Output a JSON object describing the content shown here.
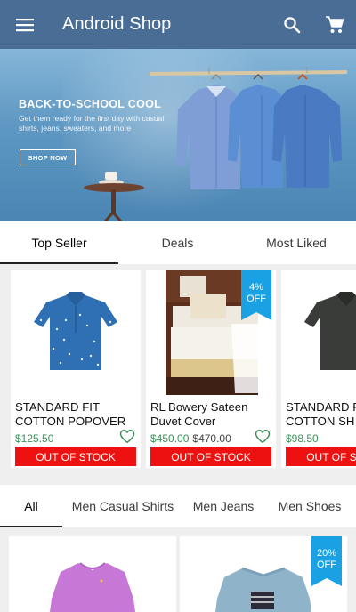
{
  "app": {
    "title": "Android Shop"
  },
  "banner": {
    "headline": "BACK-TO-SCHOOL COOL",
    "subtext": "Get them ready for the first day with casual shirts, jeans, sweaters, and more",
    "cta": "SHOP NOW",
    "slide_count": 5,
    "active_slide": 3
  },
  "section_tabs": [
    "Top Seller",
    "Deals",
    "Most Liked"
  ],
  "section_tab_active": 0,
  "products": [
    {
      "name": "STANDARD FIT COTTON POPOVER",
      "price": "$125.50",
      "old_price": "",
      "status": "OUT OF STOCK",
      "discount": ""
    },
    {
      "name": "RL Bowery Sateen Duvet Cover",
      "price": "$450.00",
      "old_price": "$470.00",
      "status": "OUT OF STOCK",
      "discount": "4% OFF"
    },
    {
      "name": "STANDARD FIT COTTON SH",
      "price": "$98.50",
      "old_price": "",
      "status": "OUT OF STOCK",
      "discount": ""
    }
  ],
  "category_tabs": [
    "All",
    "Men Casual Shirts",
    "Men Jeans",
    "Men Shoes"
  ],
  "category_tab_active": 0,
  "bottom_products": [
    {
      "discount": ""
    },
    {
      "discount": "20% OFF"
    }
  ],
  "colors": {
    "app_bar": "#4a6d96",
    "price_green": "#3e8e5a",
    "out_of_stock_red": "#ee1111",
    "discount_blue": "#1aa1e3"
  },
  "icons": [
    "menu-icon",
    "search-icon",
    "cart-icon",
    "heart-icon"
  ]
}
